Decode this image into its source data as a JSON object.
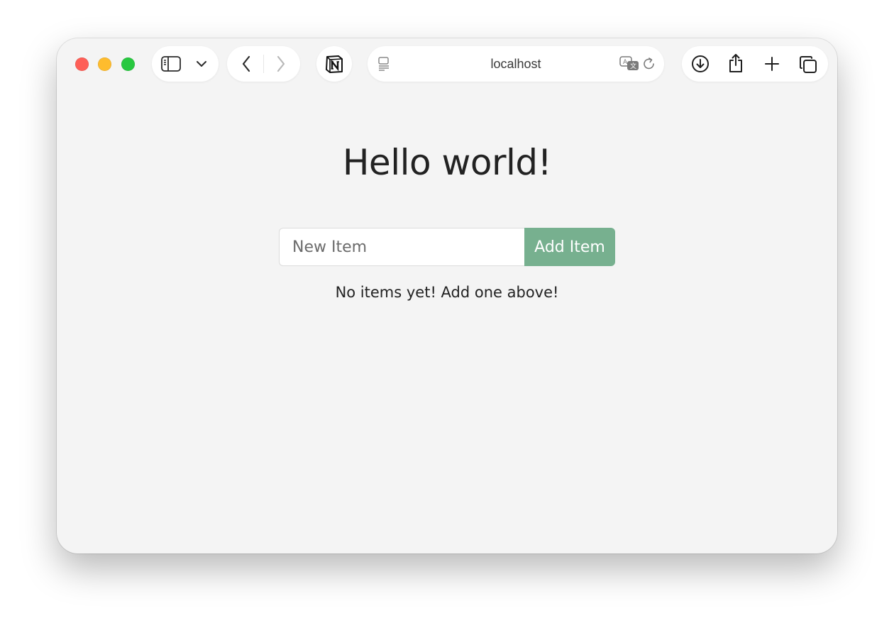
{
  "browser": {
    "address": "localhost",
    "icons": {
      "sidebar": "sidebar-icon",
      "sidebar_menu": "chevron-down-icon",
      "back": "chevron-left-icon",
      "forward": "chevron-right-icon",
      "extension": "notion-icon",
      "reader": "reader-icon",
      "translate": "translate-icon",
      "reload": "reload-icon",
      "downloads": "download-icon",
      "share": "share-icon",
      "new_tab": "plus-icon",
      "tabs": "tab-overview-icon"
    }
  },
  "page": {
    "title": "Hello world!",
    "input_placeholder": "New Item",
    "input_value": "",
    "add_button_label": "Add Item",
    "empty_message": "No items yet! Add one above!"
  },
  "colors": {
    "accent_button": "#77b08f",
    "close": "#fe5f57",
    "minimize": "#febc2e",
    "zoom": "#28c840"
  }
}
